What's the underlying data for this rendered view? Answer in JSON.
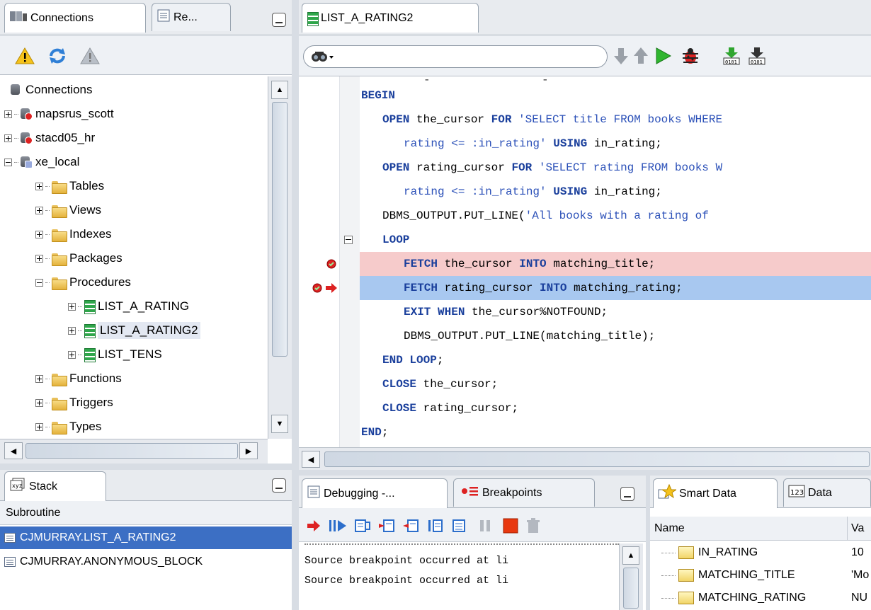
{
  "colors": {
    "accent_selection": "#3c6fc4",
    "breakpoint_line": "#f6cbcb",
    "execution_line": "#a8c8f0",
    "keyword": "#1a3f9c"
  },
  "left_top_panel": {
    "tabs": [
      {
        "label": "Connections",
        "icon": "connections-icon"
      },
      {
        "label": "Re...",
        "icon": "reports-icon"
      }
    ],
    "toolbar": [
      "warning-icon",
      "refresh-icon",
      "warning-disabled-icon"
    ],
    "tree": [
      {
        "label": "Connections",
        "icon": "connections-icon",
        "level": 0,
        "expander": "none"
      },
      {
        "label": "mapsrus_scott",
        "icon": "database-error-icon",
        "level": 0,
        "expander": "plus"
      },
      {
        "label": "stacd05_hr",
        "icon": "database-error-icon",
        "level": 0,
        "expander": "plus"
      },
      {
        "label": "xe_local",
        "icon": "database-connected-icon",
        "level": 0,
        "expander": "minus"
      },
      {
        "label": "Tables",
        "icon": "tables-folder-icon",
        "level": 1,
        "expander": "plus"
      },
      {
        "label": "Views",
        "icon": "views-folder-icon",
        "level": 1,
        "expander": "plus"
      },
      {
        "label": "Indexes",
        "icon": "indexes-folder-icon",
        "level": 1,
        "expander": "plus"
      },
      {
        "label": "Packages",
        "icon": "packages-folder-icon",
        "level": 1,
        "expander": "plus"
      },
      {
        "label": "Procedures",
        "icon": "procedures-folder-icon",
        "level": 1,
        "expander": "minus"
      },
      {
        "label": "LIST_A_RATING",
        "icon": "procedure-icon",
        "level": 2,
        "expander": "plus"
      },
      {
        "label": "LIST_A_RATING2",
        "icon": "procedure-icon",
        "level": 2,
        "expander": "plus",
        "selected": true
      },
      {
        "label": "LIST_TENS",
        "icon": "procedure-icon",
        "level": 2,
        "expander": "plus"
      },
      {
        "label": "Functions",
        "icon": "functions-folder-icon",
        "level": 1,
        "expander": "plus"
      },
      {
        "label": "Triggers",
        "icon": "triggers-folder-icon",
        "level": 1,
        "expander": "plus"
      },
      {
        "label": "Types",
        "icon": "types-folder-icon",
        "level": 1,
        "expander": "plus"
      }
    ]
  },
  "editor": {
    "tab_label": "LIST_A_RATING2",
    "toolbar_icons": [
      "find-icon",
      "step-down-icon",
      "step-up-icon",
      "run-icon",
      "debug-icon",
      "compile-icon",
      "compile-debug-icon"
    ],
    "code_lines": [
      {
        "indent": 0,
        "parts": [
          {
            "t": "kw",
            "v": "BEGIN"
          }
        ]
      },
      {
        "indent": 1,
        "parts": [
          {
            "t": "kw",
            "v": "OPEN"
          },
          {
            "t": "",
            "v": " the_cursor "
          },
          {
            "t": "kw",
            "v": "FOR"
          },
          {
            "t": "str",
            "v": " 'SELECT title FROM books WHERE"
          }
        ]
      },
      {
        "indent": 2,
        "parts": [
          {
            "t": "str",
            "v": "rating <= :in_rating'"
          },
          {
            "t": "",
            "v": " "
          },
          {
            "t": "kw",
            "v": "USING"
          },
          {
            "t": "",
            "v": " in_rating;"
          }
        ]
      },
      {
        "indent": 1,
        "parts": [
          {
            "t": "kw",
            "v": "OPEN"
          },
          {
            "t": "",
            "v": " rating_cursor "
          },
          {
            "t": "kw",
            "v": "FOR"
          },
          {
            "t": "str",
            "v": " 'SELECT rating FROM books W"
          }
        ]
      },
      {
        "indent": 2,
        "parts": [
          {
            "t": "str",
            "v": "rating <= :in_rating'"
          },
          {
            "t": "",
            "v": " "
          },
          {
            "t": "kw",
            "v": "USING"
          },
          {
            "t": "",
            "v": " in_rating;"
          }
        ]
      },
      {
        "indent": 1,
        "parts": [
          {
            "t": "",
            "v": "DBMS_OUTPUT.PUT_LINE("
          },
          {
            "t": "str",
            "v": "'All books with a rating of"
          }
        ]
      },
      {
        "indent": 1,
        "parts": [
          {
            "t": "kw",
            "v": "LOOP"
          }
        ],
        "fold": true
      },
      {
        "indent": 2,
        "parts": [
          {
            "t": "kw",
            "v": "FETCH"
          },
          {
            "t": "",
            "v": " the_cursor "
          },
          {
            "t": "kw",
            "v": "INTO"
          },
          {
            "t": "",
            "v": " matching_title;"
          }
        ],
        "highlight": "red",
        "marker": "breakpoint"
      },
      {
        "indent": 2,
        "parts": [
          {
            "t": "kw",
            "v": "FETCH"
          },
          {
            "t": "",
            "v": " rating_cursor "
          },
          {
            "t": "kw",
            "v": "INTO"
          },
          {
            "t": "",
            "v": " matching_rating;"
          }
        ],
        "highlight": "blue",
        "marker": "breakpoint-exec"
      },
      {
        "indent": 2,
        "parts": [
          {
            "t": "kw",
            "v": "EXIT WHEN"
          },
          {
            "t": "",
            "v": " the_cursor%NOTFOUND;"
          }
        ]
      },
      {
        "indent": 2,
        "parts": [
          {
            "t": "",
            "v": "DBMS_OUTPUT.PUT_LINE(matching_title);"
          }
        ]
      },
      {
        "indent": 1,
        "parts": [
          {
            "t": "kw",
            "v": "END LOOP"
          },
          {
            "t": "",
            "v": ";"
          }
        ]
      },
      {
        "indent": 1,
        "parts": [
          {
            "t": "kw",
            "v": "CLOSE"
          },
          {
            "t": "",
            "v": " the_cursor;"
          }
        ]
      },
      {
        "indent": 1,
        "parts": [
          {
            "t": "kw",
            "v": "CLOSE"
          },
          {
            "t": "",
            "v": " rating_cursor;"
          }
        ]
      },
      {
        "indent": 0,
        "parts": [
          {
            "t": "kw",
            "v": "END"
          },
          {
            "t": "",
            "v": ";"
          }
        ]
      }
    ]
  },
  "stack_panel": {
    "tab_label": "Stack",
    "column_header": "Subroutine",
    "rows": [
      {
        "label": "CJMURRAY.LIST_A_RATING2",
        "selected": true
      },
      {
        "label": "CJMURRAY.ANONYMOUS_BLOCK",
        "selected": false
      }
    ]
  },
  "debug_panel": {
    "tabs": [
      {
        "label": "Debugging -..."
      },
      {
        "label": "Breakpoints"
      }
    ],
    "toolbar_icons": [
      "find-execution-point-icon",
      "resume-icon",
      "step-over-icon",
      "step-into-icon",
      "step-out-icon",
      "step-to-end-icon",
      "pause-icon",
      "terminate-icon",
      "garbage-collect-icon"
    ],
    "console_lines": [
      "Source breakpoint occurred at li",
      "Source breakpoint occurred at li"
    ]
  },
  "data_panel": {
    "tabs": [
      {
        "label": "Smart Data"
      },
      {
        "label": "Data"
      }
    ],
    "columns": [
      "Name",
      "Va"
    ],
    "rows": [
      {
        "name": "IN_RATING",
        "value": "10"
      },
      {
        "name": "MATCHING_TITLE",
        "value": "'Mo"
      },
      {
        "name": "MATCHING_RATING",
        "value": "NU"
      }
    ]
  }
}
